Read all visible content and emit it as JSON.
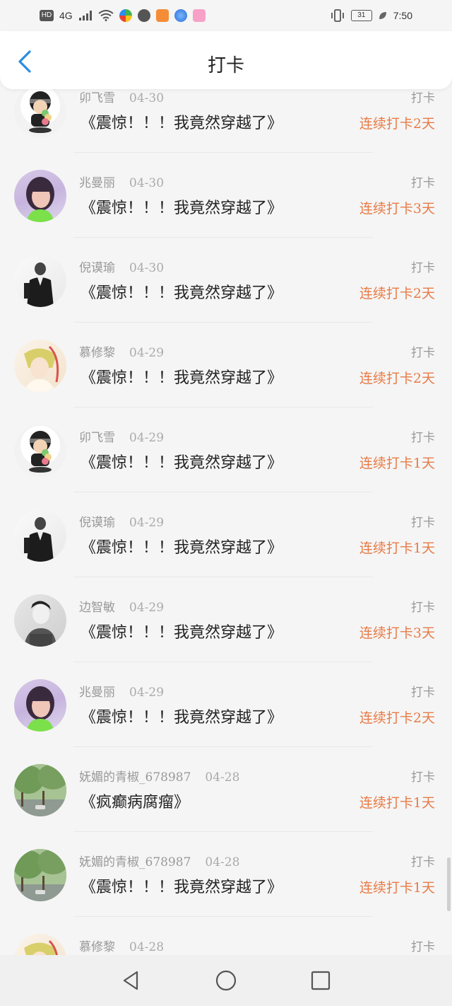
{
  "status_bar": {
    "hd": "HD",
    "network": "4G",
    "battery": "31",
    "time": "7:50"
  },
  "header": {
    "title": "打卡",
    "back_icon": "chevron-left-icon"
  },
  "accent_color": "#e87b46",
  "records": [
    {
      "name": "卯飞雪",
      "date": "04-30",
      "action": "打卡",
      "content": "《震惊！！！我竟然穿越了》",
      "streak": "连续打卡2天",
      "avatar": "ninja"
    },
    {
      "name": "兆曼丽",
      "date": "04-30",
      "action": "打卡",
      "content": "《震惊！！！我竟然穿越了》",
      "streak": "连续打卡3天",
      "avatar": "girl"
    },
    {
      "name": "倪谟瑜",
      "date": "04-30",
      "action": "打卡",
      "content": "《震惊！！！我竟然穿越了》",
      "streak": "连续打卡2天",
      "avatar": "man"
    },
    {
      "name": "慕修黎",
      "date": "04-29",
      "action": "打卡",
      "content": "《震惊！！！我竟然穿越了》",
      "streak": "连续打卡2天",
      "avatar": "anime"
    },
    {
      "name": "卯飞雪",
      "date": "04-29",
      "action": "打卡",
      "content": "《震惊！！！我竟然穿越了》",
      "streak": "连续打卡1天",
      "avatar": "ninja"
    },
    {
      "name": "倪谟瑜",
      "date": "04-29",
      "action": "打卡",
      "content": "《震惊！！！我竟然穿越了》",
      "streak": "连续打卡1天",
      "avatar": "man"
    },
    {
      "name": "边智敏",
      "date": "04-29",
      "action": "打卡",
      "content": "《震惊！！！我竟然穿越了》",
      "streak": "连续打卡3天",
      "avatar": "bw"
    },
    {
      "name": "兆曼丽",
      "date": "04-29",
      "action": "打卡",
      "content": "《震惊！！！我竟然穿越了》",
      "streak": "连续打卡2天",
      "avatar": "girl"
    },
    {
      "name": "妩媚的青椒_678987",
      "date": "04-28",
      "action": "打卡",
      "content": "《疯癫病腐瘤》",
      "streak": "连续打卡1天",
      "avatar": "tree"
    },
    {
      "name": "妩媚的青椒_678987",
      "date": "04-28",
      "action": "打卡",
      "content": "《震惊！！！我竟然穿越了》",
      "streak": "连续打卡1天",
      "avatar": "tree"
    },
    {
      "name": "慕修黎",
      "date": "04-28",
      "action": "打卡",
      "content": "",
      "streak": "",
      "avatar": "anime"
    }
  ],
  "navbar": {
    "back_icon": "triangle-back-icon",
    "home_icon": "circle-home-icon",
    "recents_icon": "square-recents-icon"
  }
}
